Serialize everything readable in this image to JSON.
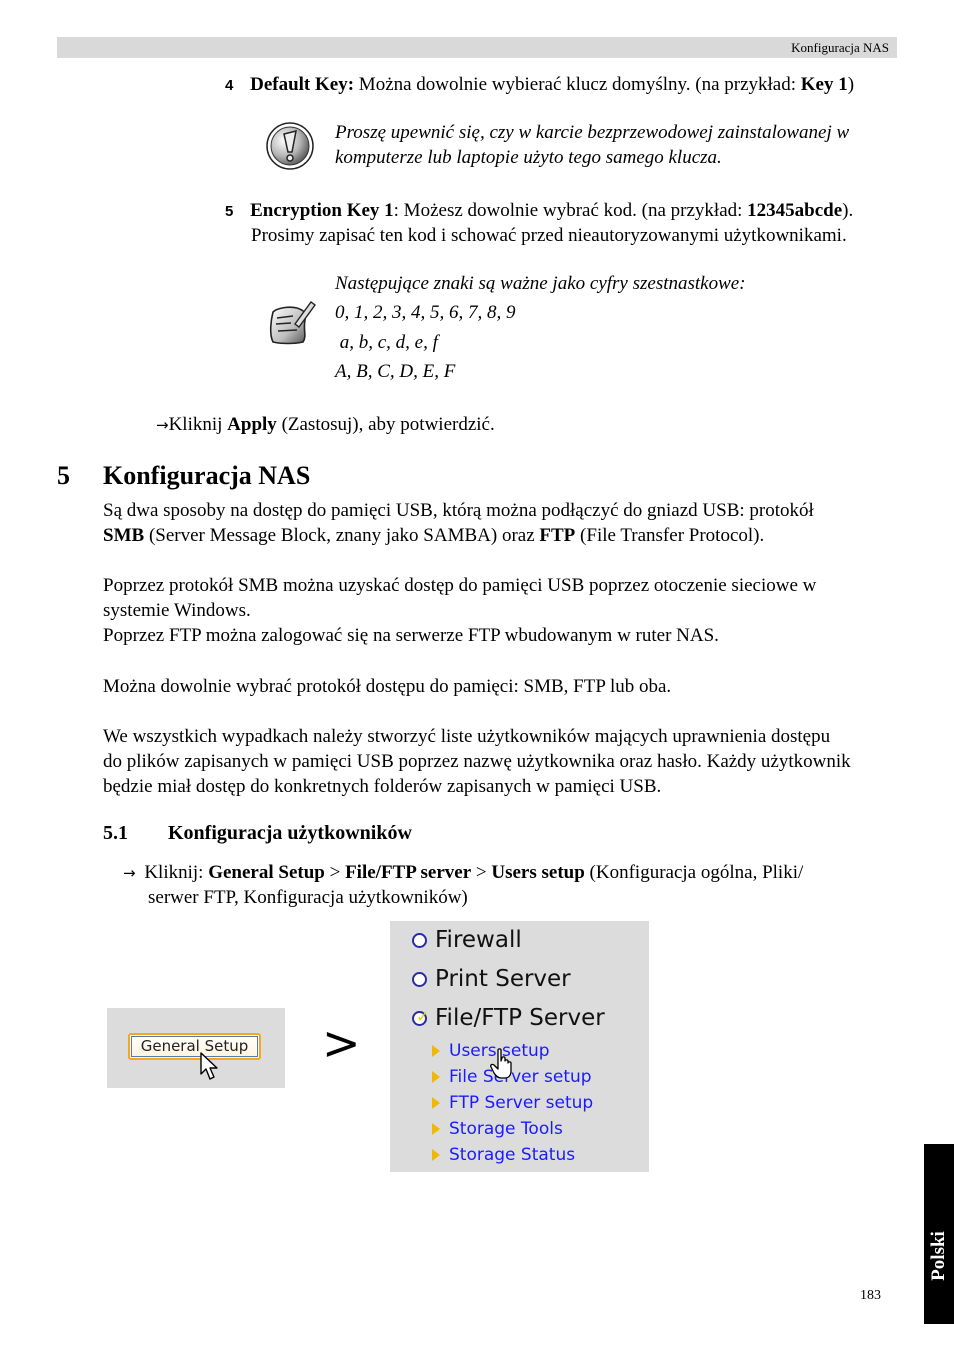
{
  "header": {
    "title": "Konfiguracja NAS"
  },
  "step4": {
    "number": "4",
    "label": "Default Key:",
    "text": " Można dowolnie wybierać klucz domyślny. (na przykład: ",
    "example": "Key 1",
    "close": ")"
  },
  "warning_note": {
    "icon": "exclamation-icon",
    "line1": "Proszę upewnić się, czy w karcie bezprzewodowej zainstalowanej w",
    "line2": "komputerze lub laptopie użyto tego samego klucza."
  },
  "step5": {
    "number": "5",
    "label": "Encryption Key 1",
    "text": ": Możesz dowolnie wybrać kod. (na przykład: ",
    "example": "12345abcde",
    "close": ").",
    "line2": "Prosimy zapisać ten kod i schować przed nieautoryzowanymi użytkownikami."
  },
  "hex_note": {
    "icon": "note-pen-icon",
    "line1": "Następujące znaki są ważne jako cyfry szestnastkowe:",
    "line2": "0, 1, 2, 3, 4, 5, 6, 7, 8, 9",
    "line3": " a, b, c, d, e, f",
    "line4": "A, B, C, D, E, F"
  },
  "apply_instruction": {
    "arrow": "→",
    "pre": "Kliknij ",
    "bold": "Apply",
    "post": " (Zastosuj), aby potwierdzić."
  },
  "section5": {
    "number": "5",
    "title": "Konfiguracja NAS",
    "p1_line1": "Są dwa sposoby na dostęp do pamięci USB, którą można podłączyć do gniazd USB: protokół",
    "p1_smb": "SMB",
    "p1_mid": " (Server Message Block, znany jako SAMBA) oraz ",
    "p1_ftp": "FTP",
    "p1_end": " (File Transfer Protocol).",
    "p2_line1": "Poprzez protokół SMB można uzyskać dostęp do pamięci USB poprzez otoczenie sieciowe w",
    "p2_line2": "systemie Windows.",
    "p2_line3": "Poprzez FTP można zalogować się na serwerze FTP wbudowanym w ruter NAS.",
    "p3": "Można dowolnie wybrać protokół dostępu do pamięci: SMB, FTP lub oba.",
    "p4_line1": "We wszystkich wypadkach należy stworzyć liste użytkowników mających uprawnienia dostępu",
    "p4_line2": "do plików zapisanych w pamięci USB poprzez nazwę użytkownika oraz hasło. Każdy użytkownik",
    "p4_line3": "będzie miał dostęp do konkretnych folderów zapisanych w pamięci USB."
  },
  "section51": {
    "number": "5.1",
    "title": "Konfiguracja użytkowników",
    "arrow": "→",
    "pre": "Kliknij: ",
    "b1": "General Setup",
    "sep1": " > ",
    "b2": "File/FTP server",
    "sep2": " > ",
    "b3": "Users setup",
    "post": " (Konfiguracja ogólna, Pliki/",
    "line2": "serwer FTP, Konfiguracja użytkowników)"
  },
  "screenshot_general": {
    "button_label": "General Setup"
  },
  "separator_symbol": ">",
  "screenshot_menu": {
    "main_items": [
      {
        "label": "Firewall",
        "selected": false
      },
      {
        "label": "Print Server",
        "selected": false
      },
      {
        "label": "File/FTP Server",
        "selected": true
      }
    ],
    "sub_items": [
      "Users setup",
      "File Server setup",
      "FTP Server setup",
      "Storage Tools",
      "Storage Status"
    ]
  },
  "side_tab": {
    "label": "Polski"
  },
  "page_number": "183"
}
